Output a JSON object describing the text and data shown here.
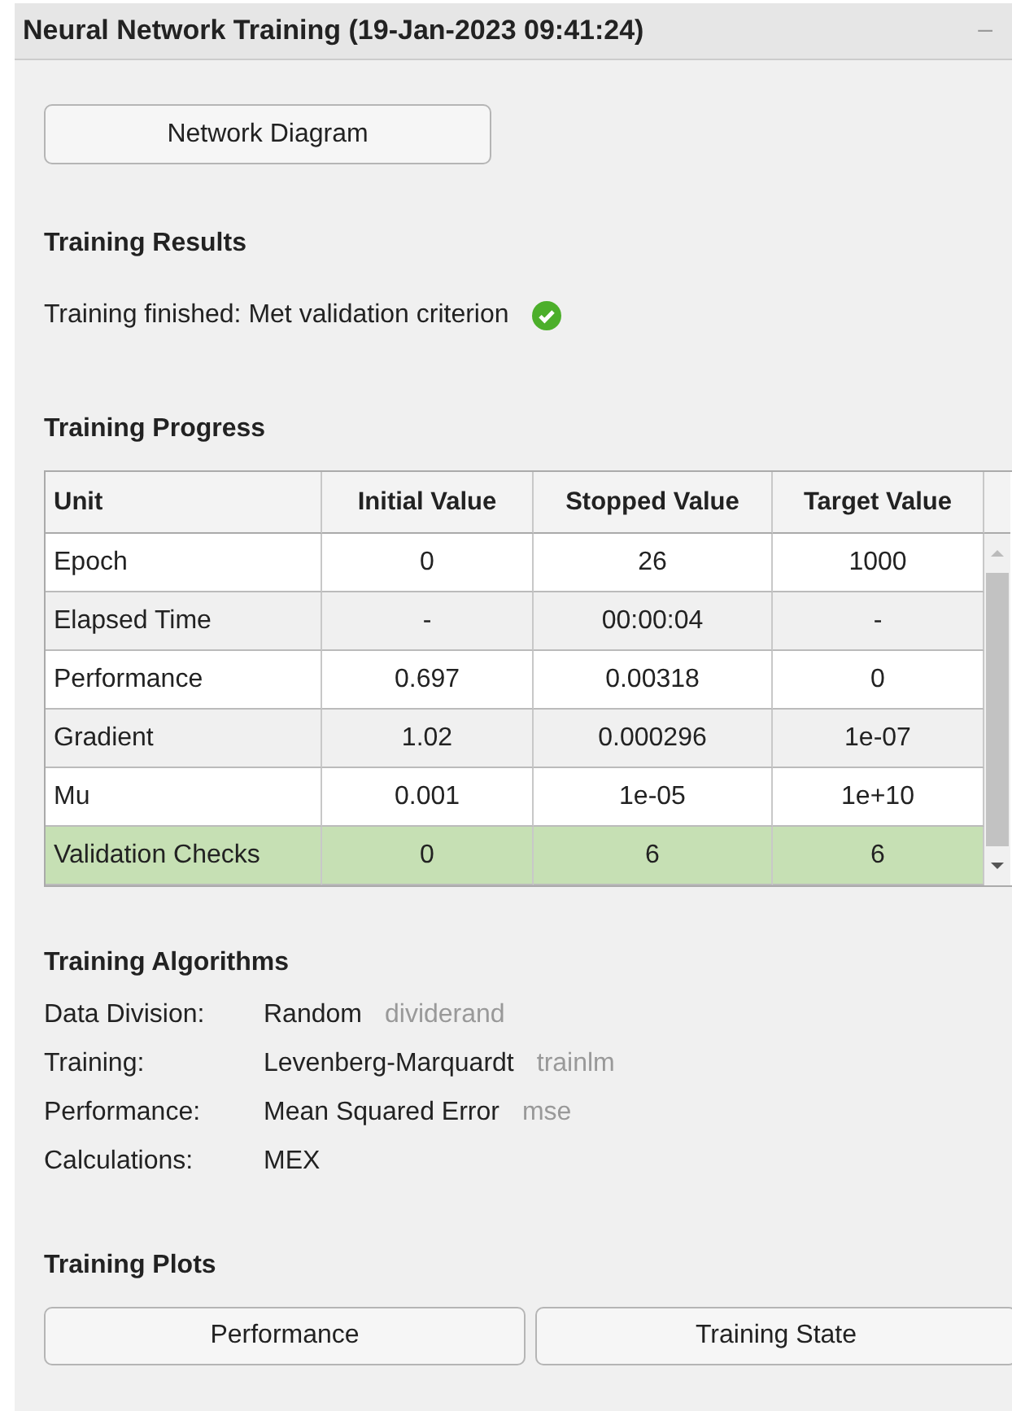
{
  "window": {
    "title": "Neural Network Training (19-Jan-2023 09:41:24)",
    "minimize": "–"
  },
  "network_button": "Network Diagram",
  "results": {
    "heading": "Training Results",
    "status": "Training finished: Met validation criterion",
    "criterion_met": true
  },
  "progress": {
    "heading": "Training Progress",
    "columns": [
      "Unit",
      "Initial Value",
      "Stopped Value",
      "Target Value"
    ],
    "rows": [
      {
        "cells": [
          "Epoch",
          "0",
          "26",
          "1000"
        ],
        "selected": false
      },
      {
        "cells": [
          "Elapsed Time",
          "-",
          "00:00:04",
          "-"
        ],
        "selected": false
      },
      {
        "cells": [
          "Performance",
          "0.697",
          "0.00318",
          "0"
        ],
        "selected": false
      },
      {
        "cells": [
          "Gradient",
          "1.02",
          "0.000296",
          "1e-07"
        ],
        "selected": false
      },
      {
        "cells": [
          "Mu",
          "0.001",
          "1e-05",
          "1e+10"
        ],
        "selected": false
      },
      {
        "cells": [
          "Validation Checks",
          "0",
          "6",
          "6"
        ],
        "selected": true
      }
    ]
  },
  "algorithms": {
    "heading": "Training Algorithms",
    "items": [
      {
        "label": "Data Division:",
        "value": "Random",
        "function": "dividerand"
      },
      {
        "label": "Training:",
        "value": "Levenberg-Marquardt",
        "function": "trainlm"
      },
      {
        "label": "Performance:",
        "value": "Mean Squared Error",
        "function": "mse"
      },
      {
        "label": "Calculations:",
        "value": "MEX"
      }
    ]
  },
  "plots": {
    "heading": "Training Plots",
    "buttons": [
      "Performance",
      "Training State"
    ]
  }
}
